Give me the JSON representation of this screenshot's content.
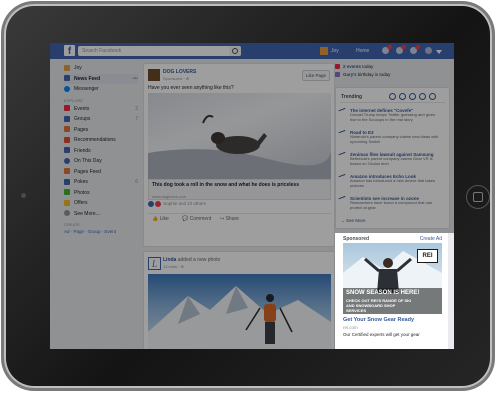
{
  "topbar": {
    "search_placeholder": "Search Facebook",
    "user_name": "Joy",
    "home_label": "Home"
  },
  "left_nav": {
    "user_name": "Joy",
    "items": [
      {
        "label": "News Feed",
        "count": "•••",
        "color": "#4267b2"
      },
      {
        "label": "Messenger",
        "count": "",
        "color": "#0084ff"
      }
    ],
    "explore_heading": "EXPLORE",
    "explore": [
      {
        "label": "Events",
        "count": "2",
        "color": "#f02849"
      },
      {
        "label": "Groups",
        "count": "7",
        "color": "#4267b2"
      },
      {
        "label": "Pages",
        "count": "",
        "color": "#e6733b"
      },
      {
        "label": "Recommendations",
        "count": "",
        "color": "#e34b3b"
      },
      {
        "label": "Friends",
        "count": "",
        "color": "#4267b2"
      },
      {
        "label": "On This Day",
        "count": "",
        "color": "#4267b2"
      },
      {
        "label": "Pages Feed",
        "count": "",
        "color": "#e6733b"
      },
      {
        "label": "Pokes",
        "count": "6",
        "color": "#4267b2"
      },
      {
        "label": "Photos",
        "count": "",
        "color": "#42b72a"
      },
      {
        "label": "Offers",
        "count": "",
        "color": "#f7b928"
      },
      {
        "label": "See More...",
        "count": "",
        "color": "#90949c"
      }
    ],
    "create_heading": "CREATE",
    "create_links": "Ad · Page · Group · Event"
  },
  "post1": {
    "page_name": "DOG LOVERS",
    "sub": "Sponsored · ⊕",
    "like_page": "Like Page",
    "text": "Have you ever seen anything like this?",
    "link_title": "This dog took a roll in the snow and what he does is priceless",
    "link_url": "www.dogloves.com",
    "reactions": "Sophie and 10 others",
    "like": "Like",
    "comment": "Comment",
    "share": "Share"
  },
  "post2": {
    "name": "Linda",
    "action": "added a new photo",
    "time": "13 mins · ⊕"
  },
  "right": {
    "events": "2 events",
    "events_suffix": "today",
    "birthday_name": "Gary",
    "birthday_suffix": "'s birthday is today",
    "trending_label": "Trending",
    "trending": [
      {
        "title": "The internet defines \"Covefe\"",
        "desc": "Donald Trump keeps Twitter guessing and gives rise to the Scooops in the real story"
      },
      {
        "title": "Road to E3",
        "desc": "Nintendo's parent company claims new ideas with upcoming Switch"
      },
      {
        "title": "Zenimax files lawsuit against Samsung",
        "desc": "Bethesda's parent company claims Gear VR is based on Oculus tech"
      },
      {
        "title": "Amazon introduces Echo Look",
        "desc": "Amazon has introduced a new device that takes pictures"
      },
      {
        "title": "Scientists see increase in ozone",
        "desc": "Researchers have found a compound that can protect at gear"
      }
    ],
    "see_more": "See More"
  },
  "ad": {
    "sponsored": "Sponsored",
    "create_ad": "Create Ad",
    "img_head": "SNOW SEASON IS HERE!",
    "img_sub": "CHECK OUT REI'S RANGE OF SKI AND SNOWBOARD SHOP SERVICES",
    "logo": "REI",
    "title": "Get Your Snow Gear Ready",
    "url": "rei.com",
    "desc": "Our Certified experts will get your gear"
  }
}
